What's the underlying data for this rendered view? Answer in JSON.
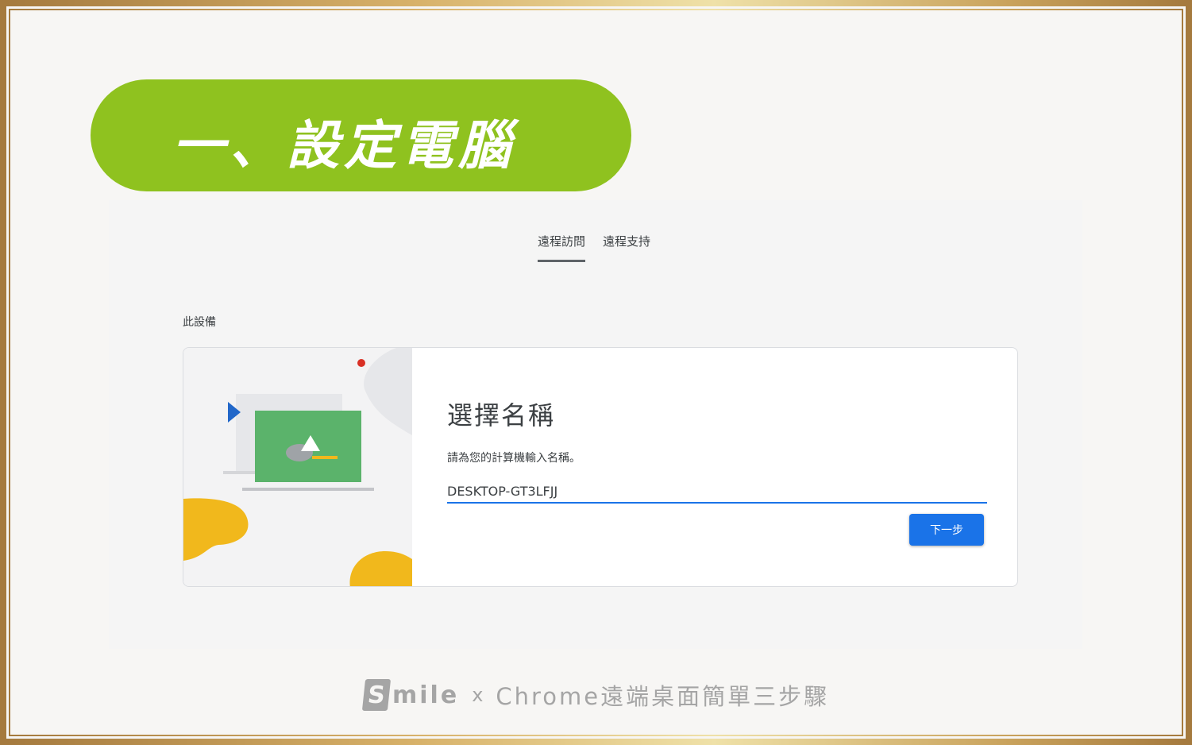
{
  "banner": {
    "title": "一、設定電腦"
  },
  "tabs": [
    {
      "label": "遠程訪問",
      "active": true
    },
    {
      "label": "遠程支持",
      "active": false
    }
  ],
  "section": {
    "label": "此設備"
  },
  "card": {
    "title": "選擇名稱",
    "instruction": "請為您的計算機輸入名稱。",
    "name_value": "DESKTOP-GT3LFJJ",
    "next_label": "下一步"
  },
  "footer": {
    "brand_s": "S",
    "brand_rest": "mile",
    "times": "x",
    "subtitle": "Chrome遠端桌面簡單三步驟"
  },
  "colors": {
    "banner_green": "#8fc21f",
    "accent_blue": "#1a73e8",
    "frame_gold": "#c29d5e",
    "illustration_green": "#5bb36b",
    "illustration_yellow": "#f1b81c",
    "illustration_red": "#d93025"
  }
}
